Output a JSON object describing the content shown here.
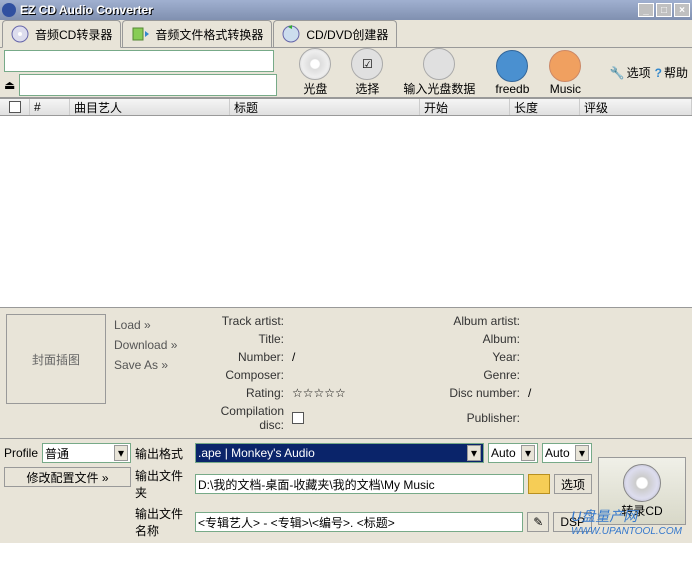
{
  "window": {
    "title": "EZ CD Audio Converter"
  },
  "tabs": [
    {
      "label": "音频CD转录器"
    },
    {
      "label": "音频文件格式转换器"
    },
    {
      "label": "CD/DVD创建器"
    }
  ],
  "toplinks": {
    "options": "选项",
    "help": "帮助"
  },
  "toolbar": {
    "disc": "光盘",
    "select": "选择",
    "inputdata": "输入光盘数据",
    "freedb": "freedb",
    "music": "Music"
  },
  "columns": {
    "num": "#",
    "artist": "曲目艺人",
    "title": "标题",
    "start": "开始",
    "length": "长度",
    "rating": "评级"
  },
  "cover": {
    "label": "封面插图"
  },
  "load": {
    "load": "Load »",
    "download": "Download »",
    "saveas": "Save As »"
  },
  "meta": {
    "trackartist": "Track artist:",
    "title": "Title:",
    "number": "Number:",
    "numval": "/",
    "composer": "Composer:",
    "rating": "Rating:",
    "compilation": "Compilation disc:",
    "albumartist": "Album artist:",
    "album": "Album:",
    "year": "Year:",
    "genre": "Genre:",
    "discnum": "Disc number:",
    "discval": "/",
    "publisher": "Publisher:"
  },
  "bottom": {
    "profile": "Profile",
    "profileval": "普通",
    "editprofile": "修改配置文件 »",
    "outformat": "输出格式",
    "formatval": ".ape | Monkey's Audio",
    "auto1": "Auto",
    "auto2": "Auto",
    "outfolder": "输出文件夹",
    "folderval": "D:\\我的文档-桌面-收藏夹\\我的文档\\My Music",
    "optbtn": "选项",
    "outfilename": "输出文件名称",
    "filenameval": "<专辑艺人> - <专辑>\\<编号>. <标题>",
    "dsp": "DSP",
    "rip": "转录CD"
  },
  "watermark": {
    "t1": "U盘量产网",
    "t2": "WWW.UPANTOOL.COM"
  }
}
